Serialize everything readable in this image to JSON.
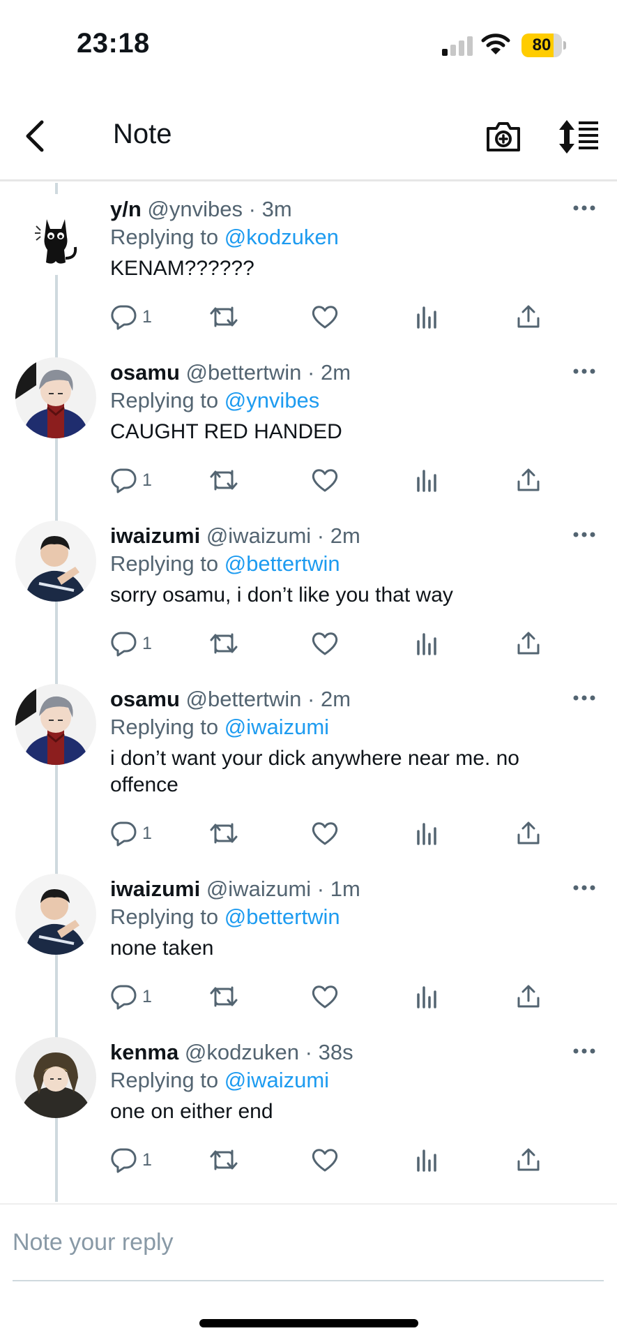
{
  "status_bar": {
    "time": "23:18",
    "battery": "80",
    "battery_level": 0.8
  },
  "header": {
    "title": "Note"
  },
  "tweets": [
    {
      "name": "y/n",
      "handle": "@ynvibes",
      "time": "· 3m",
      "replying_prefix": "Replying to",
      "replying_to": "@kodzuken",
      "text": "KENAM??????",
      "reply_count": "1",
      "avatar": "black-cat-avatar"
    },
    {
      "name": "osamu",
      "handle": "@bettertwin",
      "time": "· 2m",
      "replying_prefix": "Replying to",
      "replying_to": "@ynvibes",
      "text": "CAUGHT RED HANDED",
      "reply_count": "1",
      "avatar": "osamu-avatar"
    },
    {
      "name": "iwaizumi",
      "handle": "@iwaizumi",
      "time": "· 2m",
      "replying_prefix": "Replying to",
      "replying_to": "@bettertwin",
      "text": "sorry osamu, i don’t like you that way",
      "reply_count": "1",
      "avatar": "iwaizumi-avatar"
    },
    {
      "name": "osamu",
      "handle": "@bettertwin",
      "time": "· 2m",
      "replying_prefix": "Replying to",
      "replying_to": "@iwaizumi",
      "text": "i don’t want your dick anywhere near me. no offence",
      "reply_count": "1",
      "avatar": "osamu-avatar"
    },
    {
      "name": "iwaizumi",
      "handle": "@iwaizumi",
      "time": "· 1m",
      "replying_prefix": "Replying to",
      "replying_to": "@bettertwin",
      "text": "none taken",
      "reply_count": "1",
      "avatar": "iwaizumi-avatar"
    },
    {
      "name": "kenma",
      "handle": "@kodzuken",
      "time": "· 38s",
      "replying_prefix": "Replying to",
      "replying_to": "@iwaizumi",
      "text": "one on either end",
      "reply_count": "1",
      "avatar": "kenma-avatar"
    }
  ],
  "composer": {
    "placeholder": "Note your reply"
  },
  "colors": {
    "link": "#1d9bf0",
    "meta": "#536471",
    "battery": "#ffcc00"
  }
}
